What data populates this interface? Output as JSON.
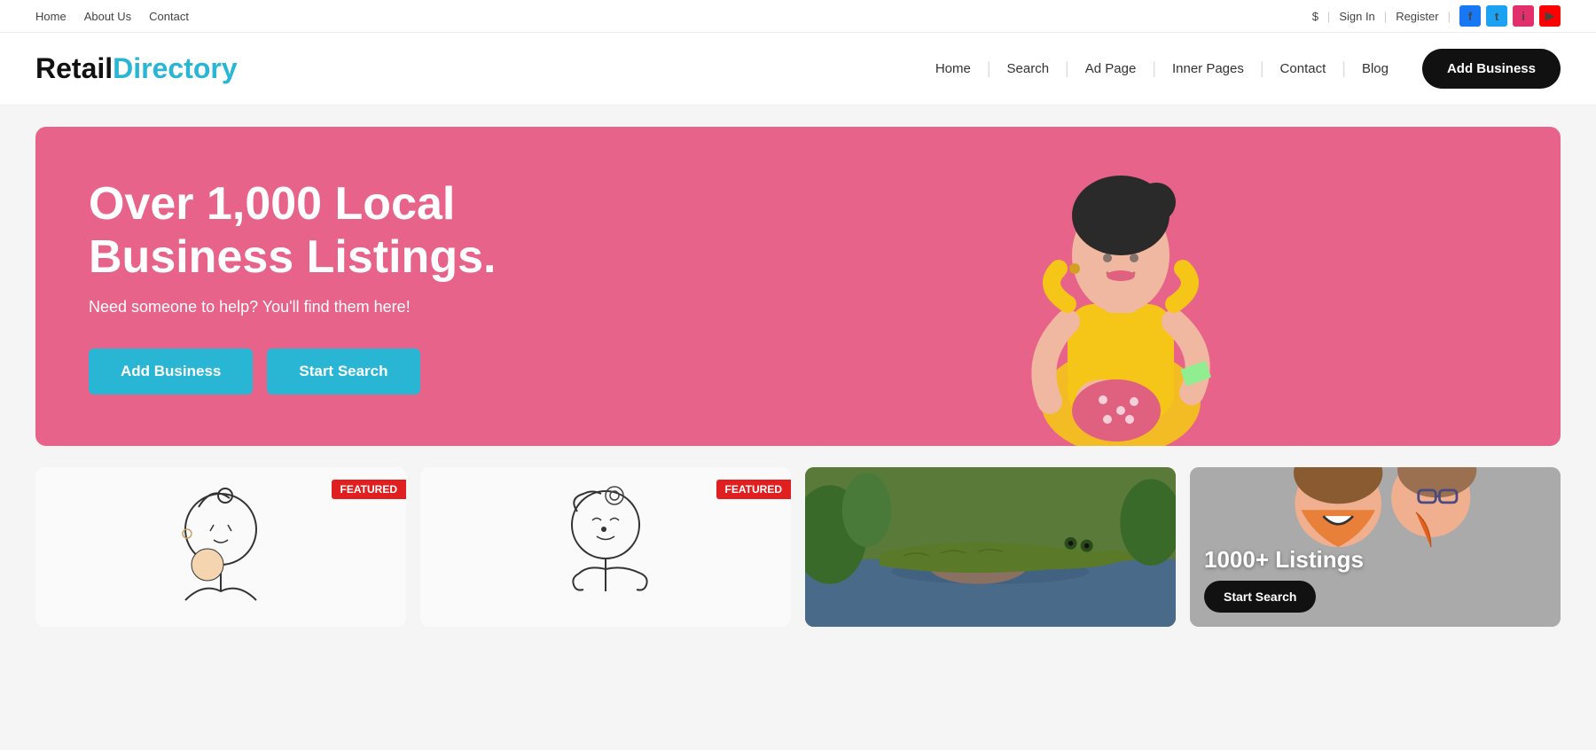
{
  "topbar": {
    "nav": [
      {
        "label": "Home",
        "id": "topbar-home"
      },
      {
        "label": "About Us",
        "id": "topbar-about"
      },
      {
        "label": "Contact",
        "id": "topbar-contact"
      }
    ],
    "currency_icon": "$",
    "sign_in": "Sign In",
    "register": "Register",
    "social": [
      {
        "name": "facebook",
        "label": "f",
        "class": "social-fb"
      },
      {
        "name": "twitter",
        "label": "t",
        "class": "social-tw"
      },
      {
        "name": "instagram",
        "label": "i",
        "class": "social-ig"
      },
      {
        "name": "youtube",
        "label": "▶",
        "class": "social-yt"
      }
    ]
  },
  "header": {
    "logo_retail": "Retail",
    "logo_directory": "Directory",
    "nav": [
      {
        "label": "Home"
      },
      {
        "label": "Search"
      },
      {
        "label": "Ad Page"
      },
      {
        "label": "Inner Pages"
      },
      {
        "label": "Contact"
      },
      {
        "label": "Blog"
      }
    ],
    "add_business_btn": "Add Business"
  },
  "hero": {
    "title": "Over 1,000 Local Business Listings.",
    "subtitle": "Need someone to help? You'll find them here!",
    "btn_add": "Add Business",
    "btn_search": "Start Search",
    "bg_color": "#e8638a"
  },
  "cards": [
    {
      "type": "art",
      "featured": true,
      "badge_label": "FEATURED"
    },
    {
      "type": "art2",
      "featured": true,
      "badge_label": "FEATURED"
    },
    {
      "type": "photo",
      "featured": false
    },
    {
      "type": "listings",
      "count": "1000+ Listings",
      "btn_label": "Start Search"
    }
  ]
}
